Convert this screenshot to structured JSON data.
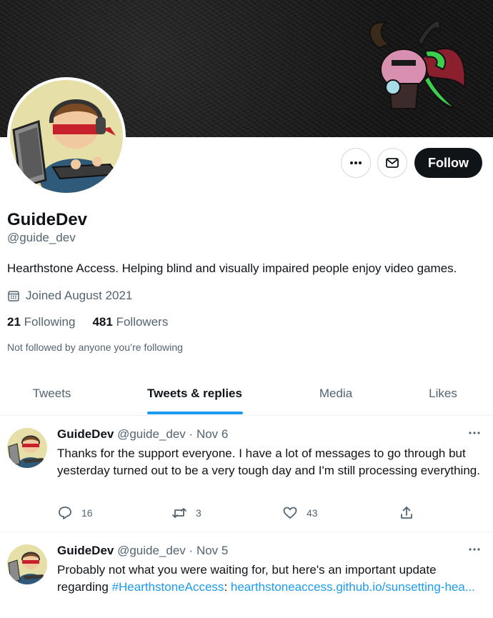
{
  "profile": {
    "display_name": "GuideDev",
    "handle": "@guide_dev",
    "bio": "Hearthstone Access. Helping blind and visually impaired people enjoy video games.",
    "joined": "Joined August 2021",
    "following_count": "21",
    "following_label": "Following",
    "followers_count": "481",
    "followers_label": "Followers",
    "not_followed_text": "Not followed by anyone you’re following"
  },
  "actions": {
    "more_icon": "more-horizontal-icon",
    "message_icon": "envelope-icon",
    "follow_label": "Follow"
  },
  "tabs": [
    {
      "label": "Tweets",
      "active": false
    },
    {
      "label": "Tweets & replies",
      "active": true
    },
    {
      "label": "Media",
      "active": false
    },
    {
      "label": "Likes",
      "active": false
    }
  ],
  "tweets": [
    {
      "name": "GuideDev",
      "handle": "@guide_dev",
      "separator": "·",
      "date": "Nov 6",
      "text": "Thanks for the support everyone. I have a lot of messages to go through but yesterday turned out to be a very tough day and I'm still processing everything.",
      "replies": "16",
      "retweets": "3",
      "likes": "43"
    },
    {
      "name": "GuideDev",
      "handle": "@guide_dev",
      "separator": "·",
      "date": "Nov 5",
      "text_before": "Probably not what you were waiting for, but here's an important update regarding ",
      "hashtag": "#HearthstoneAccess",
      "text_middle": ": ",
      "link": "hearthstoneaccess.github.io/sunsetting-hea..."
    }
  ],
  "colors": {
    "accent": "#1d9bf0",
    "text_primary": "#0f1419",
    "text_secondary": "#536471",
    "follow_bg": "#0f1419",
    "divider": "#eff3f4"
  }
}
